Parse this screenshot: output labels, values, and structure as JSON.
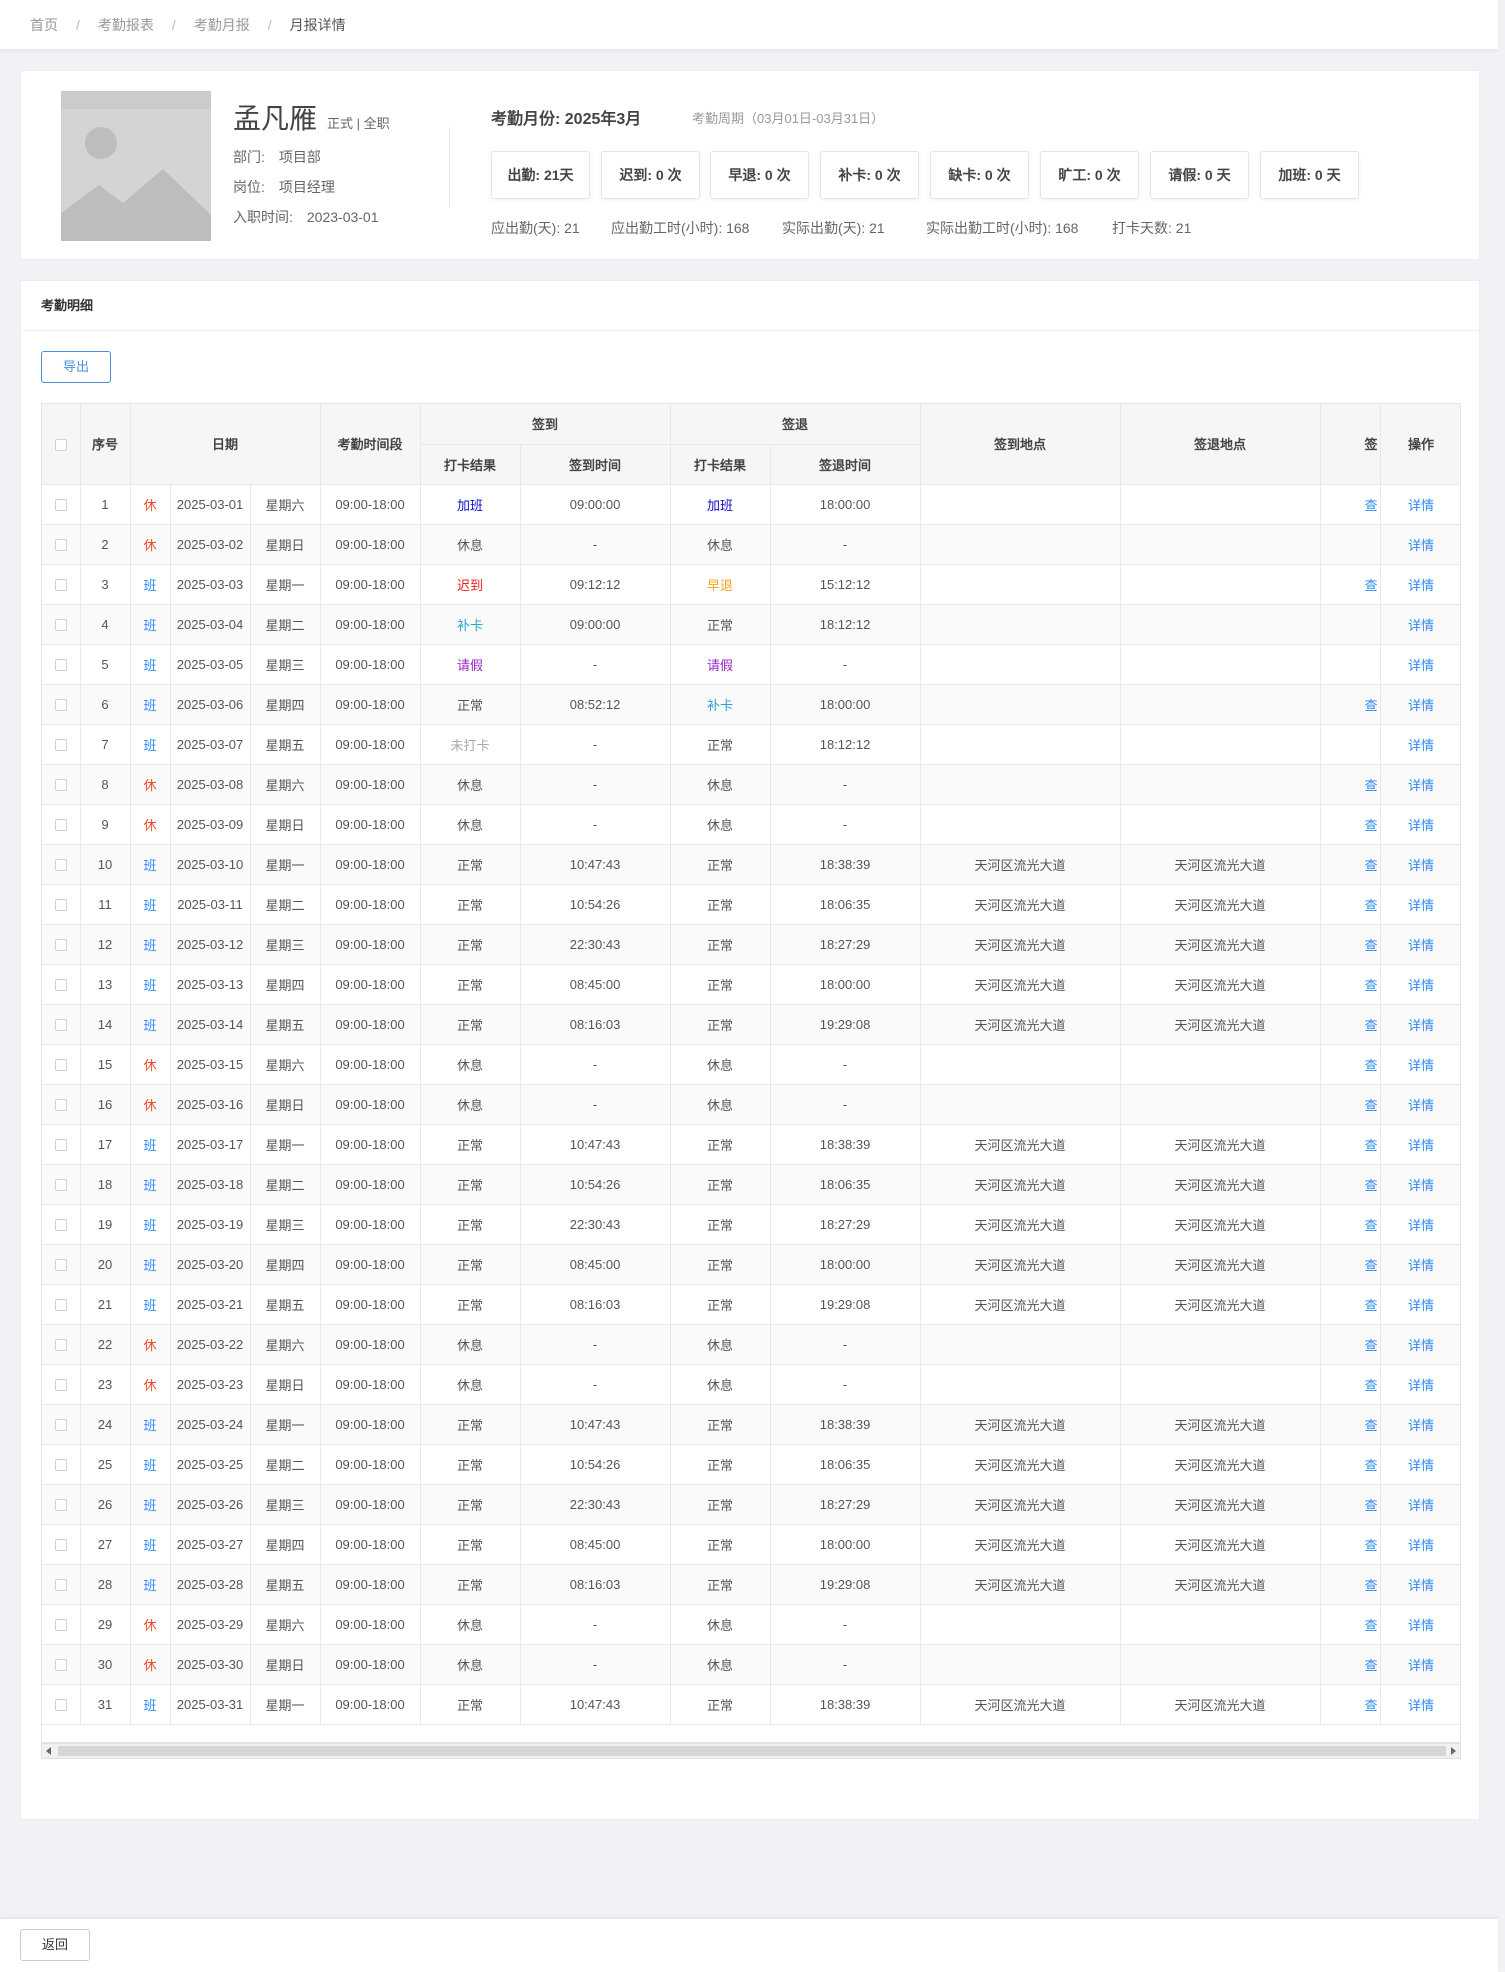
{
  "breadcrumb": [
    "首页",
    "考勤报表",
    "考勤月报",
    "月报详情"
  ],
  "profile": {
    "name": "孟凡雁",
    "employment_type": "正式 | 全职",
    "department_label": "部门:",
    "department": "项目部",
    "position_label": "岗位:",
    "position": "项目经理",
    "hire_label": "入职时间:",
    "hire_date": "2023-03-01"
  },
  "summary": {
    "month_label": "考勤月份: 2025年3月",
    "period": "考勤周期（03月01日-03月31日）",
    "stats": [
      "出勤: 21天",
      "迟到: 0 次",
      "早退: 0 次",
      "补卡: 0 次",
      "缺卡: 0 次",
      "旷工: 0 次",
      "请假: 0 天",
      "加班: 0 天"
    ],
    "details": [
      "应出勤(天): 21",
      "应出勤工时(小时): 168",
      "实际出勤(天): 21",
      "实际出勤工时(小时): 168",
      "打卡天数: 21"
    ]
  },
  "detail": {
    "title": "考勤明细",
    "export_label": "导出",
    "headers": {
      "seq": "序号",
      "date": "日期",
      "period": "考勤时间段",
      "sign_in": "签到",
      "sign_out": "签退",
      "punch_result": "打卡结果",
      "sign_in_time": "签到时间",
      "sign_out_time": "签退时间",
      "sign_in_place": "签到地点",
      "sign_out_place": "签退地点",
      "cut_col": "签",
      "action": "操作"
    },
    "rows": [
      {
        "no": "1",
        "type": "休",
        "date": "2025-03-01",
        "weekday": "星期六",
        "period": "09:00-18:00",
        "in_result": "加班",
        "in_time": "09:00:00",
        "out_result": "加班",
        "out_time": "18:00:00",
        "in_place": "",
        "out_place": "",
        "cut": "查",
        "action": "详情"
      },
      {
        "no": "2",
        "type": "休",
        "date": "2025-03-02",
        "weekday": "星期日",
        "period": "09:00-18:00",
        "in_result": "休息",
        "in_time": "-",
        "out_result": "休息",
        "out_time": "-",
        "in_place": "",
        "out_place": "",
        "cut": "",
        "action": "详情"
      },
      {
        "no": "3",
        "type": "班",
        "date": "2025-03-03",
        "weekday": "星期一",
        "period": "09:00-18:00",
        "in_result": "迟到",
        "in_time": "09:12:12",
        "out_result": "早退",
        "out_time": "15:12:12",
        "in_place": "",
        "out_place": "",
        "cut": "查",
        "action": "详情"
      },
      {
        "no": "4",
        "type": "班",
        "date": "2025-03-04",
        "weekday": "星期二",
        "period": "09:00-18:00",
        "in_result": "补卡",
        "in_time": "09:00:00",
        "out_result": "正常",
        "out_time": "18:12:12",
        "in_place": "",
        "out_place": "",
        "cut": "",
        "action": "详情"
      },
      {
        "no": "5",
        "type": "班",
        "date": "2025-03-05",
        "weekday": "星期三",
        "period": "09:00-18:00",
        "in_result": "请假",
        "in_time": "-",
        "out_result": "请假",
        "out_time": "-",
        "in_place": "",
        "out_place": "",
        "cut": "",
        "action": "详情"
      },
      {
        "no": "6",
        "type": "班",
        "date": "2025-03-06",
        "weekday": "星期四",
        "period": "09:00-18:00",
        "in_result": "正常",
        "in_time": "08:52:12",
        "out_result": "补卡",
        "out_time": "18:00:00",
        "in_place": "",
        "out_place": "",
        "cut": "查",
        "action": "详情"
      },
      {
        "no": "7",
        "type": "班",
        "date": "2025-03-07",
        "weekday": "星期五",
        "period": "09:00-18:00",
        "in_result": "未打卡",
        "in_time": "-",
        "out_result": "正常",
        "out_time": "18:12:12",
        "in_place": "",
        "out_place": "",
        "cut": "",
        "action": "详情"
      },
      {
        "no": "8",
        "type": "休",
        "date": "2025-03-08",
        "weekday": "星期六",
        "period": "09:00-18:00",
        "in_result": "休息",
        "in_time": "-",
        "out_result": "休息",
        "out_time": "-",
        "in_place": "",
        "out_place": "",
        "cut": "查",
        "action": "详情"
      },
      {
        "no": "9",
        "type": "休",
        "date": "2025-03-09",
        "weekday": "星期日",
        "period": "09:00-18:00",
        "in_result": "休息",
        "in_time": "-",
        "out_result": "休息",
        "out_time": "-",
        "in_place": "",
        "out_place": "",
        "cut": "查",
        "action": "详情"
      },
      {
        "no": "10",
        "type": "班",
        "date": "2025-03-10",
        "weekday": "星期一",
        "period": "09:00-18:00",
        "in_result": "正常",
        "in_time": "10:47:43",
        "out_result": "正常",
        "out_time": "18:38:39",
        "in_place": "天河区流光大道",
        "out_place": "天河区流光大道",
        "cut": "查",
        "action": "详情"
      },
      {
        "no": "11",
        "type": "班",
        "date": "2025-03-11",
        "weekday": "星期二",
        "period": "09:00-18:00",
        "in_result": "正常",
        "in_time": "10:54:26",
        "out_result": "正常",
        "out_time": "18:06:35",
        "in_place": "天河区流光大道",
        "out_place": "天河区流光大道",
        "cut": "查",
        "action": "详情"
      },
      {
        "no": "12",
        "type": "班",
        "date": "2025-03-12",
        "weekday": "星期三",
        "period": "09:00-18:00",
        "in_result": "正常",
        "in_time": "22:30:43",
        "out_result": "正常",
        "out_time": "18:27:29",
        "in_place": "天河区流光大道",
        "out_place": "天河区流光大道",
        "cut": "查",
        "action": "详情"
      },
      {
        "no": "13",
        "type": "班",
        "date": "2025-03-13",
        "weekday": "星期四",
        "period": "09:00-18:00",
        "in_result": "正常",
        "in_time": "08:45:00",
        "out_result": "正常",
        "out_time": "18:00:00",
        "in_place": "天河区流光大道",
        "out_place": "天河区流光大道",
        "cut": "查",
        "action": "详情"
      },
      {
        "no": "14",
        "type": "班",
        "date": "2025-03-14",
        "weekday": "星期五",
        "period": "09:00-18:00",
        "in_result": "正常",
        "in_time": "08:16:03",
        "out_result": "正常",
        "out_time": "19:29:08",
        "in_place": "天河区流光大道",
        "out_place": "天河区流光大道",
        "cut": "查",
        "action": "详情"
      },
      {
        "no": "15",
        "type": "休",
        "date": "2025-03-15",
        "weekday": "星期六",
        "period": "09:00-18:00",
        "in_result": "休息",
        "in_time": "-",
        "out_result": "休息",
        "out_time": "-",
        "in_place": "",
        "out_place": "",
        "cut": "查",
        "action": "详情"
      },
      {
        "no": "16",
        "type": "休",
        "date": "2025-03-16",
        "weekday": "星期日",
        "period": "09:00-18:00",
        "in_result": "休息",
        "in_time": "-",
        "out_result": "休息",
        "out_time": "-",
        "in_place": "",
        "out_place": "",
        "cut": "查",
        "action": "详情"
      },
      {
        "no": "17",
        "type": "班",
        "date": "2025-03-17",
        "weekday": "星期一",
        "period": "09:00-18:00",
        "in_result": "正常",
        "in_time": "10:47:43",
        "out_result": "正常",
        "out_time": "18:38:39",
        "in_place": "天河区流光大道",
        "out_place": "天河区流光大道",
        "cut": "查",
        "action": "详情"
      },
      {
        "no": "18",
        "type": "班",
        "date": "2025-03-18",
        "weekday": "星期二",
        "period": "09:00-18:00",
        "in_result": "正常",
        "in_time": "10:54:26",
        "out_result": "正常",
        "out_time": "18:06:35",
        "in_place": "天河区流光大道",
        "out_place": "天河区流光大道",
        "cut": "查",
        "action": "详情"
      },
      {
        "no": "19",
        "type": "班",
        "date": "2025-03-19",
        "weekday": "星期三",
        "period": "09:00-18:00",
        "in_result": "正常",
        "in_time": "22:30:43",
        "out_result": "正常",
        "out_time": "18:27:29",
        "in_place": "天河区流光大道",
        "out_place": "天河区流光大道",
        "cut": "查",
        "action": "详情"
      },
      {
        "no": "20",
        "type": "班",
        "date": "2025-03-20",
        "weekday": "星期四",
        "period": "09:00-18:00",
        "in_result": "正常",
        "in_time": "08:45:00",
        "out_result": "正常",
        "out_time": "18:00:00",
        "in_place": "天河区流光大道",
        "out_place": "天河区流光大道",
        "cut": "查",
        "action": "详情"
      },
      {
        "no": "21",
        "type": "班",
        "date": "2025-03-21",
        "weekday": "星期五",
        "period": "09:00-18:00",
        "in_result": "正常",
        "in_time": "08:16:03",
        "out_result": "正常",
        "out_time": "19:29:08",
        "in_place": "天河区流光大道",
        "out_place": "天河区流光大道",
        "cut": "查",
        "action": "详情"
      },
      {
        "no": "22",
        "type": "休",
        "date": "2025-03-22",
        "weekday": "星期六",
        "period": "09:00-18:00",
        "in_result": "休息",
        "in_time": "-",
        "out_result": "休息",
        "out_time": "-",
        "in_place": "",
        "out_place": "",
        "cut": "查",
        "action": "详情"
      },
      {
        "no": "23",
        "type": "休",
        "date": "2025-03-23",
        "weekday": "星期日",
        "period": "09:00-18:00",
        "in_result": "休息",
        "in_time": "-",
        "out_result": "休息",
        "out_time": "-",
        "in_place": "",
        "out_place": "",
        "cut": "查",
        "action": "详情"
      },
      {
        "no": "24",
        "type": "班",
        "date": "2025-03-24",
        "weekday": "星期一",
        "period": "09:00-18:00",
        "in_result": "正常",
        "in_time": "10:47:43",
        "out_result": "正常",
        "out_time": "18:38:39",
        "in_place": "天河区流光大道",
        "out_place": "天河区流光大道",
        "cut": "查",
        "action": "详情"
      },
      {
        "no": "25",
        "type": "班",
        "date": "2025-03-25",
        "weekday": "星期二",
        "period": "09:00-18:00",
        "in_result": "正常",
        "in_time": "10:54:26",
        "out_result": "正常",
        "out_time": "18:06:35",
        "in_place": "天河区流光大道",
        "out_place": "天河区流光大道",
        "cut": "查",
        "action": "详情"
      },
      {
        "no": "26",
        "type": "班",
        "date": "2025-03-26",
        "weekday": "星期三",
        "period": "09:00-18:00",
        "in_result": "正常",
        "in_time": "22:30:43",
        "out_result": "正常",
        "out_time": "18:27:29",
        "in_place": "天河区流光大道",
        "out_place": "天河区流光大道",
        "cut": "查",
        "action": "详情"
      },
      {
        "no": "27",
        "type": "班",
        "date": "2025-03-27",
        "weekday": "星期四",
        "period": "09:00-18:00",
        "in_result": "正常",
        "in_time": "08:45:00",
        "out_result": "正常",
        "out_time": "18:00:00",
        "in_place": "天河区流光大道",
        "out_place": "天河区流光大道",
        "cut": "查",
        "action": "详情"
      },
      {
        "no": "28",
        "type": "班",
        "date": "2025-03-28",
        "weekday": "星期五",
        "period": "09:00-18:00",
        "in_result": "正常",
        "in_time": "08:16:03",
        "out_result": "正常",
        "out_time": "19:29:08",
        "in_place": "天河区流光大道",
        "out_place": "天河区流光大道",
        "cut": "查",
        "action": "详情"
      },
      {
        "no": "29",
        "type": "休",
        "date": "2025-03-29",
        "weekday": "星期六",
        "period": "09:00-18:00",
        "in_result": "休息",
        "in_time": "-",
        "out_result": "休息",
        "out_time": "-",
        "in_place": "",
        "out_place": "",
        "cut": "查",
        "action": "详情"
      },
      {
        "no": "30",
        "type": "休",
        "date": "2025-03-30",
        "weekday": "星期日",
        "period": "09:00-18:00",
        "in_result": "休息",
        "in_time": "-",
        "out_result": "休息",
        "out_time": "-",
        "in_place": "",
        "out_place": "",
        "cut": "查",
        "action": "详情"
      },
      {
        "no": "31",
        "type": "班",
        "date": "2025-03-31",
        "weekday": "星期一",
        "period": "09:00-18:00",
        "in_result": "正常",
        "in_time": "10:47:43",
        "out_result": "正常",
        "out_time": "18:38:39",
        "in_place": "天河区流光大道",
        "out_place": "天河区流光大道",
        "cut": "查",
        "action": "详情"
      }
    ]
  },
  "footer": {
    "back_label": "返回"
  },
  "colors": {
    "rest_day": "#e84a2e",
    "work_day": "#2d8cf0",
    "overtime": "#1010c8",
    "late": "#e42222",
    "early_leave": "#f5a623",
    "make_up": "#2aa5c8",
    "leave": "#9b25c8",
    "missed": "#aaaaaa"
  }
}
